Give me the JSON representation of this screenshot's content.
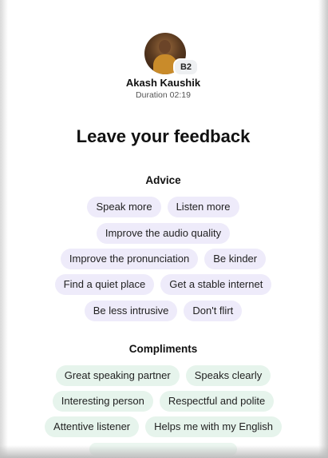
{
  "colors": {
    "advice_chip_bg": "#eeebfa",
    "compliment_chip_bg": "#e6f4ec",
    "text": "#111111"
  },
  "profile": {
    "name": "Akash Kaushik",
    "duration": "Duration 02:19",
    "level_badge": "B2"
  },
  "title": "Leave your feedback",
  "advice": {
    "heading": "Advice",
    "rows": [
      [
        "Speak more",
        "Listen more"
      ],
      [
        "Improve the audio quality"
      ],
      [
        "Improve the pronunciation",
        "Be kinder"
      ],
      [
        "Find a quiet place",
        "Get a stable internet"
      ],
      [
        "Be less intrusive",
        "Don't flirt"
      ]
    ]
  },
  "compliments": {
    "heading": "Compliments",
    "rows": [
      [
        "Great speaking partner",
        "Speaks clearly"
      ],
      [
        "Interesting person",
        "Respectful and polite"
      ],
      [
        "Attentive listener",
        "Helps me with my English"
      ]
    ]
  }
}
